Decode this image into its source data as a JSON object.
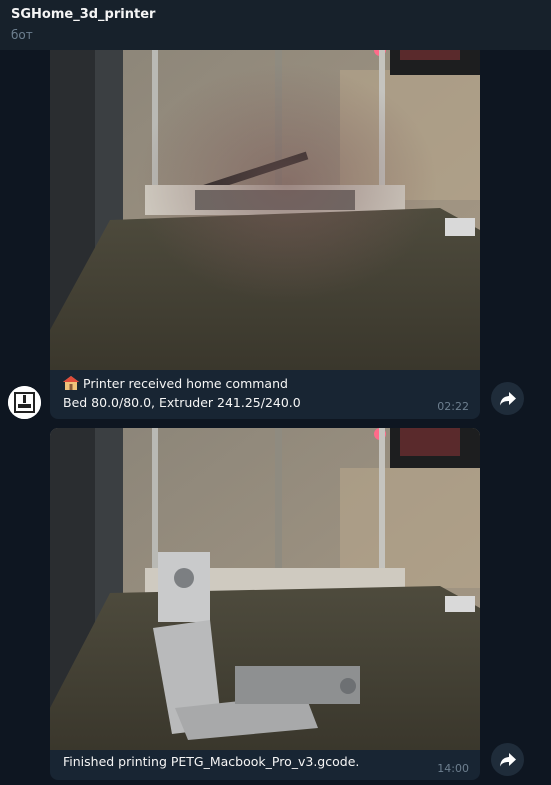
{
  "header": {
    "title": "SGHome_3d_printer",
    "subtitle": "бот"
  },
  "messages": [
    {
      "line1": "Printer received home command",
      "line2": "Bed 80.0/80.0, Extruder 241.25/240.0",
      "time": "02:22",
      "icon": "house-icon"
    },
    {
      "line1": "Finished printing PETG_Macbook_Pro_v3.gcode.",
      "time": "14:00"
    }
  ],
  "avatar": {
    "icon": "printer-avatar-icon"
  },
  "forward": {
    "icon": "share-arrow-icon"
  },
  "colors": {
    "background": "#0e1621",
    "header": "#17212b",
    "bubble": "#182533",
    "muted": "#6d7f8f"
  }
}
